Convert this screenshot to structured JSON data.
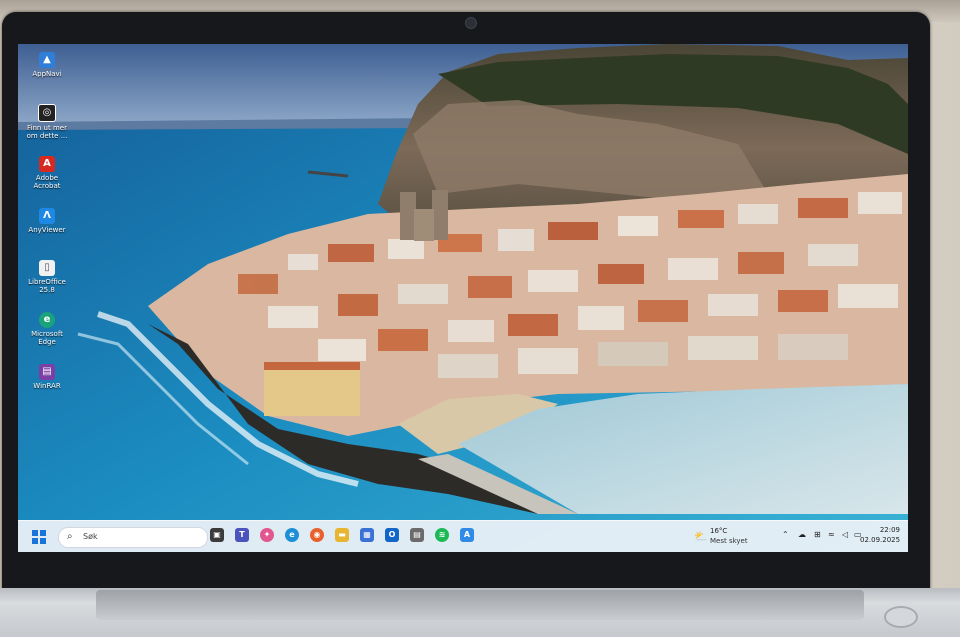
{
  "desktop": {
    "icons": [
      {
        "label": "AppNavi",
        "icon": "app-navigator-icon",
        "color": "#2f7fd8"
      },
      {
        "label": "Finn ut mer om dette ...",
        "icon": "camera-icon",
        "color": "#222222"
      },
      {
        "label": "Adobe Acrobat",
        "icon": "acrobat-icon",
        "color": "#d62a20"
      },
      {
        "label": "AnyViewer",
        "icon": "anyviewer-icon",
        "color": "#1e88e5"
      },
      {
        "label": "LibreOffice 25.8",
        "icon": "libreoffice-icon",
        "color": "#f1f1f1"
      },
      {
        "label": "Microsoft Edge",
        "icon": "edge-icon",
        "color": "#1aa37a"
      },
      {
        "label": "WinRAR",
        "icon": "winrar-icon",
        "color": "#7b3fa6"
      }
    ]
  },
  "taskbar": {
    "search_placeholder": "Søk",
    "pinned": [
      {
        "icon": "task-view-icon",
        "color": "#3b3b3b",
        "glyph": "▣"
      },
      {
        "icon": "teams-icon",
        "color": "#4b53bc",
        "glyph": "T"
      },
      {
        "icon": "copilot-icon",
        "color": "#e0568f",
        "glyph": "✦"
      },
      {
        "icon": "edge-icon",
        "color": "#1c8fd6",
        "glyph": "e"
      },
      {
        "icon": "firefox-icon",
        "color": "#e8612c",
        "glyph": "◉"
      },
      {
        "icon": "file-explorer-icon",
        "color": "#e8b530",
        "glyph": "▬"
      },
      {
        "icon": "store-icon",
        "color": "#3b70d6",
        "glyph": "▦"
      },
      {
        "icon": "outlook-icon",
        "color": "#1266c7",
        "glyph": "O"
      },
      {
        "icon": "calendar-icon",
        "color": "#6b6b6b",
        "glyph": "▤"
      },
      {
        "icon": "spotify-icon",
        "color": "#1db954",
        "glyph": "≋"
      },
      {
        "icon": "anyviewer-icon",
        "color": "#2f8be6",
        "glyph": "A"
      }
    ],
    "weather": {
      "temp": "16°C",
      "condition": "Mest skyet",
      "icon": "partly-cloudy-icon"
    },
    "tray": [
      {
        "icon": "chevron-up-icon",
        "glyph": "⌃"
      },
      {
        "icon": "cloud-icon",
        "glyph": "☁"
      },
      {
        "icon": "network-icon",
        "glyph": "⊞"
      },
      {
        "icon": "wifi-icon",
        "glyph": "≈"
      },
      {
        "icon": "volume-icon",
        "glyph": "◁"
      },
      {
        "icon": "battery-icon",
        "glyph": "▭"
      }
    ],
    "clock": {
      "time": "22:09",
      "date": "02.09.2025"
    }
  },
  "colors": {
    "taskbar": "#eef2f8",
    "start": "#1a73d9",
    "sea": "#1d7fae"
  }
}
